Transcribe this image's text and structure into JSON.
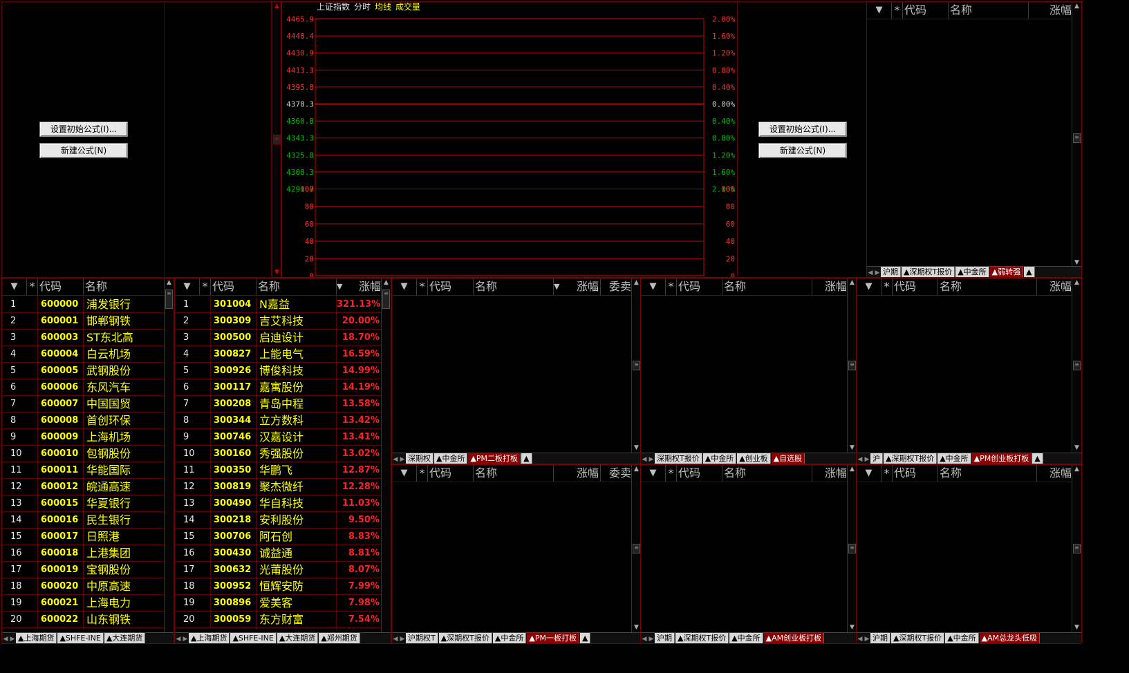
{
  "colors": {
    "grid_red": "#c00000",
    "border": "#7a0000",
    "code_yellow": "#ffff00",
    "pct_red": "#ff2020",
    "green_axis": "#00c000",
    "tab_active": "#8b0000"
  },
  "formula_buttons": {
    "set_initial": "设置初始公式(I)...",
    "new_formula": "新建公式(N)"
  },
  "chart": {
    "title_parts": [
      "上证指数",
      "分时",
      "均线",
      "成交量"
    ],
    "left_labels": [
      "4465.9",
      "4448.4",
      "4430.9",
      "4413.3",
      "4395.8",
      "4378.3",
      "4360.8",
      "4343.3",
      "4325.8",
      "4308.3",
      "4290.7"
    ],
    "right_labels": [
      "2.00%",
      "1.60%",
      "1.20%",
      "0.80%",
      "0.40%",
      "0.00%",
      "0.40%",
      "0.80%",
      "1.20%",
      "1.60%",
      "2.00%"
    ],
    "volume_labels_left": [
      "100",
      "80",
      "60",
      "40",
      "20",
      "0"
    ],
    "volume_labels_right": [
      "100",
      "80",
      "60",
      "40",
      "20",
      "0"
    ]
  },
  "chart_data": {
    "type": "line",
    "title": "上证指数",
    "ylim": [
      4290.7,
      4465.9
    ],
    "series": [],
    "center_value": 4378.3
  },
  "header_labels": {
    "star": "*",
    "code": "代码",
    "name": "名称",
    "change": "涨幅",
    "bid_ask": "委卖",
    "dropdown": "▼"
  },
  "table_left": {
    "rows": [
      [
        "1",
        "600000",
        "浦发银行"
      ],
      [
        "2",
        "600001",
        "邯郸钢铁"
      ],
      [
        "3",
        "600003",
        "ST东北高"
      ],
      [
        "4",
        "600004",
        "白云机场"
      ],
      [
        "5",
        "600005",
        "武钢股份"
      ],
      [
        "6",
        "600006",
        "东风汽车"
      ],
      [
        "7",
        "600007",
        "中国国贸"
      ],
      [
        "8",
        "600008",
        "首创环保"
      ],
      [
        "9",
        "600009",
        "上海机场"
      ],
      [
        "10",
        "600010",
        "包钢股份"
      ],
      [
        "11",
        "600011",
        "华能国际"
      ],
      [
        "12",
        "600012",
        "皖通高速"
      ],
      [
        "13",
        "600015",
        "华夏银行"
      ],
      [
        "14",
        "600016",
        "民生银行"
      ],
      [
        "15",
        "600017",
        "日照港"
      ],
      [
        "16",
        "600018",
        "上港集团"
      ],
      [
        "17",
        "600019",
        "宝钢股份"
      ],
      [
        "18",
        "600020",
        "中原高速"
      ],
      [
        "19",
        "600021",
        "上海电力"
      ],
      [
        "20",
        "600022",
        "山东钢铁"
      ]
    ],
    "tabs": [
      "▲上海期货",
      "▲SHFE-INE",
      "▲大连期货"
    ]
  },
  "table_right": {
    "rows": [
      [
        "1",
        "301004",
        "N嘉益",
        "321.13%"
      ],
      [
        "2",
        "300309",
        "吉艾科技",
        "20.00%"
      ],
      [
        "3",
        "300500",
        "启迪设计",
        "18.70%"
      ],
      [
        "4",
        "300827",
        "上能电气",
        "16.59%"
      ],
      [
        "5",
        "300926",
        "博俊科技",
        "14.99%"
      ],
      [
        "6",
        "300117",
        "嘉寓股份",
        "14.19%"
      ],
      [
        "7",
        "300208",
        "青岛中程",
        "13.58%"
      ],
      [
        "8",
        "300344",
        "立方数科",
        "13.42%"
      ],
      [
        "9",
        "300746",
        "汉嘉设计",
        "13.41%"
      ],
      [
        "10",
        "300160",
        "秀强股份",
        "13.02%"
      ],
      [
        "11",
        "300350",
        "华鹏飞",
        "12.87%"
      ],
      [
        "12",
        "300819",
        "聚杰微纤",
        "12.28%"
      ],
      [
        "13",
        "300490",
        "华自科技",
        "11.03%"
      ],
      [
        "14",
        "300218",
        "安利股份",
        "9.50%"
      ],
      [
        "15",
        "300706",
        "阿石创",
        "8.83%"
      ],
      [
        "16",
        "300430",
        "诚益通",
        "8.81%"
      ],
      [
        "17",
        "300632",
        "光莆股份",
        "8.07%"
      ],
      [
        "18",
        "300952",
        "恒辉安防",
        "7.99%"
      ],
      [
        "19",
        "300896",
        "爱美客",
        "7.98%"
      ],
      [
        "20",
        "300059",
        "东方财富",
        "7.54%"
      ]
    ],
    "tabs": [
      "▲上海期货",
      "▲SHFE-INE",
      "▲大连期货",
      "▲郑州期货"
    ]
  },
  "tabsets": {
    "top_right": [
      "沪期",
      "▲深期权T报价",
      "▲中金所",
      "▲弱转强",
      "▲"
    ],
    "mid_a": [
      "深期权",
      "▲中金所",
      "▲PM二板打板",
      "▲"
    ],
    "mid_b": [
      "深期权T报价",
      "▲中金所",
      "▲创业板",
      "▲自选股"
    ],
    "mid_c": [
      "沪",
      "▲深期权T报价",
      "▲中金所",
      "▲PM创业板打板",
      "▲"
    ],
    "bot_a": [
      "沪期权T",
      "▲深期权T报价",
      "▲中金所",
      "▲PM一板打板",
      "▲"
    ],
    "bot_b": [
      "沪期",
      "▲深期权T报价",
      "▲中金所",
      "▲AM创业板打板"
    ],
    "bot_c": [
      "沪期",
      "▲深期权T报价",
      "▲中金所",
      "▲AM总龙头低吸"
    ]
  }
}
